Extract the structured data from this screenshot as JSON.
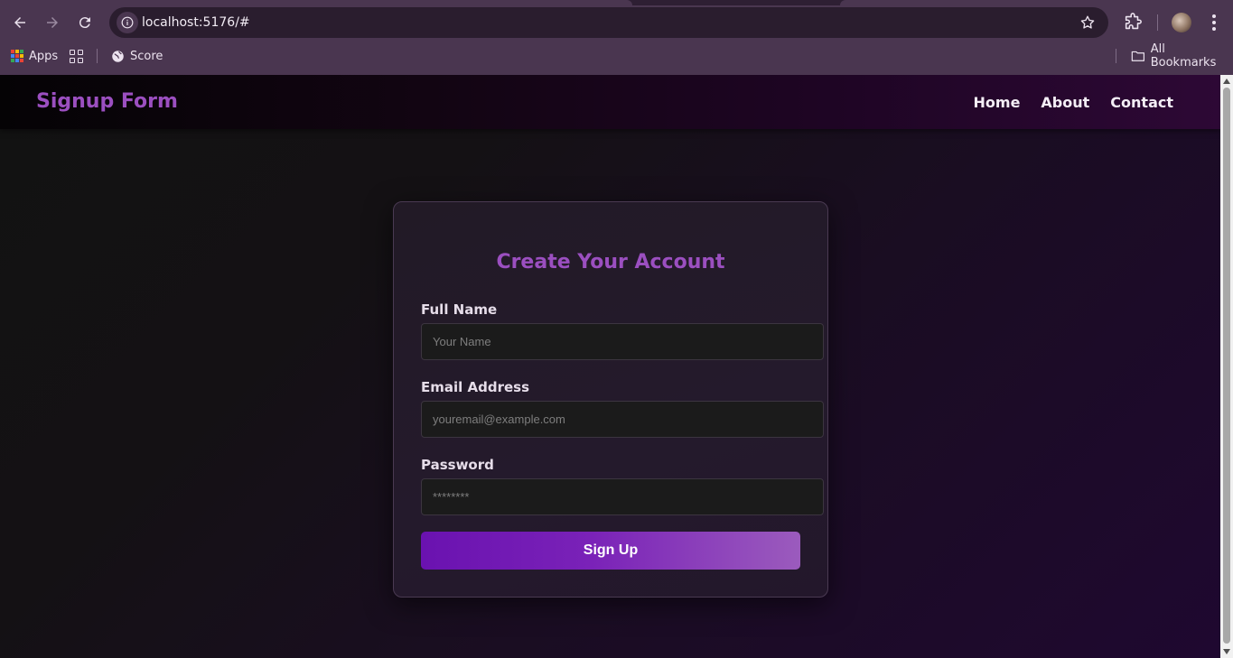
{
  "browser": {
    "url": "localhost:5176/#",
    "bookmarks": [
      {
        "label": "Apps",
        "icon": "apps-grid-icon"
      },
      {
        "label": "",
        "icon": "tab-groups-icon"
      },
      {
        "label": "Score",
        "icon": "globe-icon"
      }
    ],
    "all_bookmarks_label": "All Bookmarks"
  },
  "site": {
    "brand": "Signup Form",
    "nav": [
      "Home",
      "About",
      "Contact"
    ],
    "accent": "#9b4fc0"
  },
  "form": {
    "title": "Create Your Account",
    "fields": [
      {
        "label": "Full Name",
        "placeholder": "Your Name",
        "type": "text"
      },
      {
        "label": "Email Address",
        "placeholder": "youremail@example.com",
        "type": "email"
      },
      {
        "label": "Password",
        "placeholder": "********",
        "type": "password"
      }
    ],
    "submit_label": "Sign Up"
  }
}
